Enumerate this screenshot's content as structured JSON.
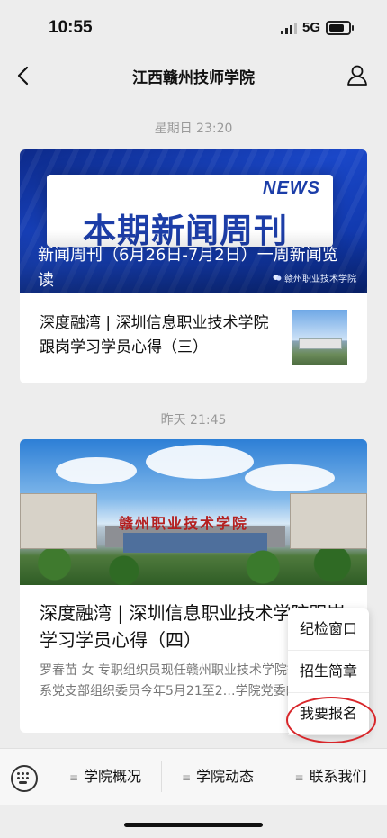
{
  "status_bar": {
    "time": "10:55",
    "network": "5G"
  },
  "nav": {
    "title": "江西赣州技师学院"
  },
  "messages": [
    {
      "timestamp": "星期日 23:20",
      "banner": {
        "news_tag": "NEWS",
        "headline": "本期新闻周刊",
        "caption": "新闻周刊（6月26日-7月2日）一周新闻览读",
        "watermark": "赣州职业技术学院"
      },
      "item": {
        "text": "深度融湾 | 深圳信息职业技术学院跟岗学习学员心得（三）"
      }
    },
    {
      "timestamp": "昨天 21:45",
      "banner": {
        "gate_name": "赣州职业技术学院"
      },
      "headline": "深度融湾 | 深圳信息职业技术学院跟岗学习学员心得（四）",
      "digest": "罗春苗 女 专职组织员现任赣州职业技术学院智能制造系党支部组织委员今年5月21至2…学院党委的精心"
    }
  ],
  "popup_menu": {
    "items": [
      "纪检窗口",
      "招生简章",
      "我要报名"
    ]
  },
  "bottom_menu": {
    "tabs": [
      "学院概况",
      "学院动态",
      "联系我们"
    ]
  },
  "colors": {
    "highlight_circle": "#d8262a",
    "banner_blue": "#1a47c8"
  }
}
